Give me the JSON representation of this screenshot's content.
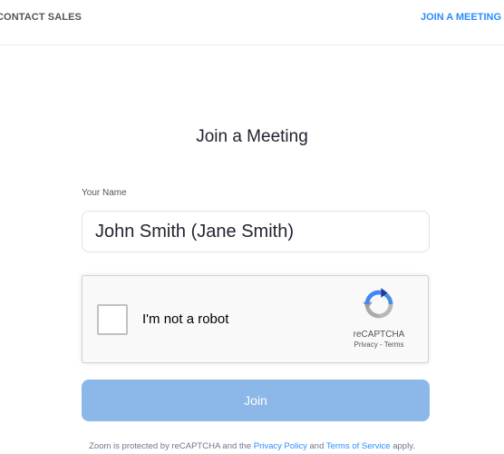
{
  "topbar": {
    "contact_sales": "CONTACT SALES",
    "join_meeting": "JOIN A MEETING"
  },
  "page": {
    "title": "Join a Meeting"
  },
  "form": {
    "name_label": "Your Name",
    "name_value": "John Smith (Jane Smith)",
    "join_button": "Join"
  },
  "recaptcha": {
    "label": "I'm not a robot",
    "brand": "reCAPTCHA",
    "privacy": "Privacy",
    "separator": " - ",
    "terms": "Terms",
    "checked": false
  },
  "footer": {
    "prefix": "Zoom is protected by reCAPTCHA and the ",
    "privacy_link": "Privacy Policy",
    "middle": " and ",
    "terms_link": "Terms of Service",
    "suffix": " apply."
  },
  "colors": {
    "accent": "#2d8cff",
    "button_disabled": "#8bb8e8",
    "text": "#232333",
    "muted": "#747487"
  }
}
